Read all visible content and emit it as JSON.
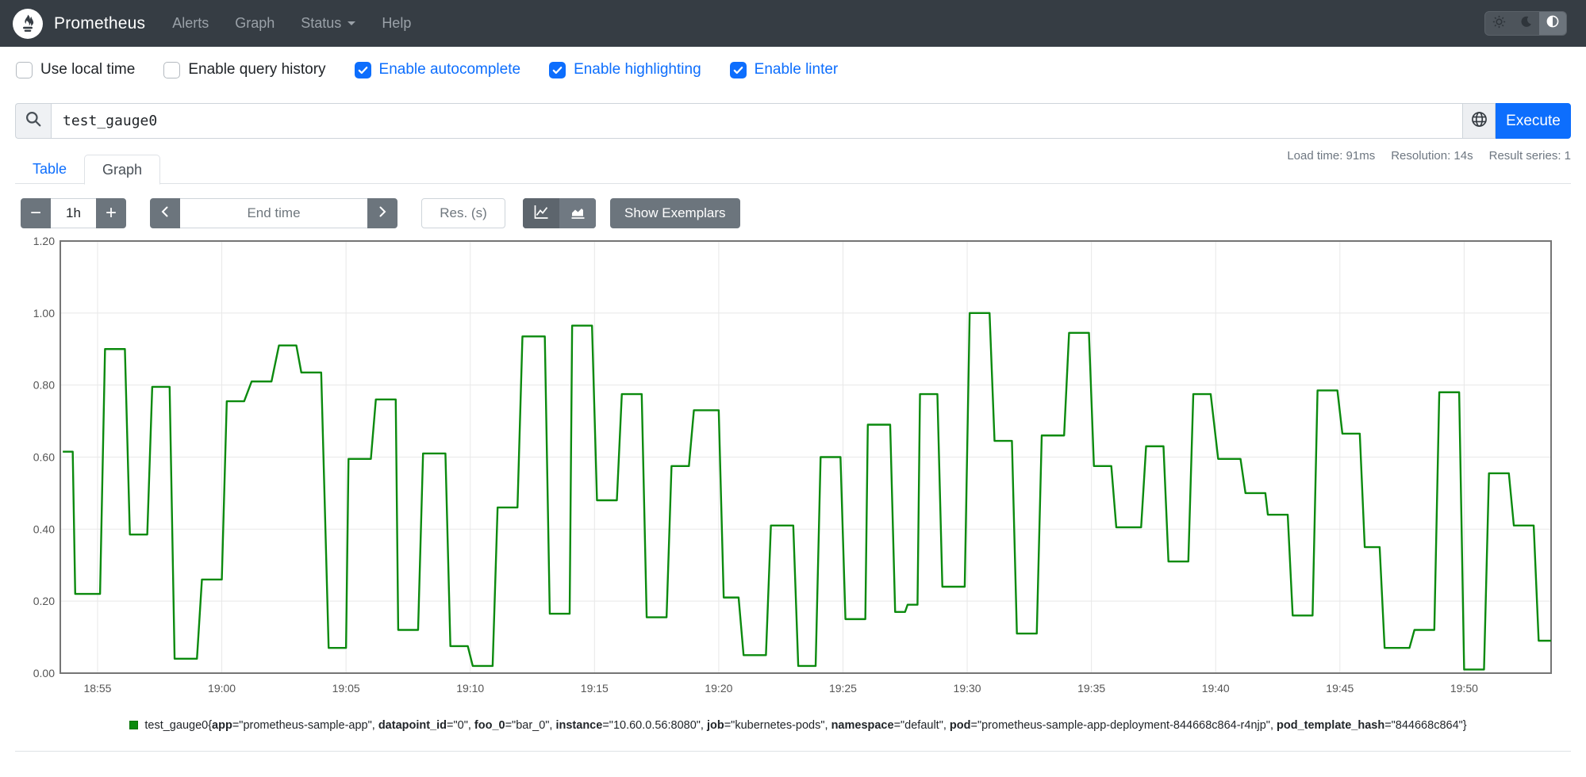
{
  "colors": {
    "accent": "#0d6efd",
    "navbar_bg": "#363d44",
    "series_green": "#0b8a0e",
    "grid": "#e8e8e8",
    "frame": "#757575",
    "tick_text": "#555555"
  },
  "navbar": {
    "brand": "Prometheus",
    "links": [
      {
        "label": "Alerts"
      },
      {
        "label": "Graph"
      },
      {
        "label": "Status"
      },
      {
        "label": "Help"
      }
    ],
    "theme_options": [
      "light",
      "dark",
      "auto"
    ],
    "active_theme": "auto"
  },
  "options": {
    "checkboxes": [
      {
        "label": "Use local time",
        "checked": false
      },
      {
        "label": "Enable query history",
        "checked": false
      },
      {
        "label": "Enable autocomplete",
        "checked": true
      },
      {
        "label": "Enable highlighting",
        "checked": true
      },
      {
        "label": "Enable linter",
        "checked": true
      }
    ]
  },
  "query": {
    "value": "test_gauge0",
    "execute_label": "Execute"
  },
  "stats": {
    "load_time": "Load time: 91ms",
    "resolution": "Resolution: 14s",
    "result_series": "Result series: 1"
  },
  "tabs": [
    {
      "label": "Table",
      "active": false
    },
    {
      "label": "Graph",
      "active": true
    }
  ],
  "graph_controls": {
    "minus": "−",
    "plus": "+",
    "range_value": "1h",
    "end_time_placeholder": "End time",
    "res_placeholder": "Res. (s)",
    "show_exemplars": "Show Exemplars"
  },
  "chart_data": {
    "type": "line",
    "step": true,
    "series_name": "test_gauge0",
    "series_color": "#0b8a0e",
    "ylabel": "",
    "xlabel": "",
    "y_axis": {
      "range": [
        0,
        1.2
      ],
      "tick_labels": [
        "0.00",
        "0.20",
        "0.40",
        "0.60",
        "0.80",
        "1.00",
        "1.20"
      ],
      "tick_values": [
        0,
        0.2,
        0.4,
        0.6,
        0.8,
        1.0,
        1.2
      ]
    },
    "x_axis": {
      "base_time": "18:50",
      "range_minutes": [
        3.5,
        63.5
      ],
      "tick_minutes": [
        5,
        10,
        15,
        20,
        25,
        30,
        35,
        40,
        45,
        50,
        55,
        60
      ],
      "tick_labels": [
        "18:55",
        "19:00",
        "19:05",
        "19:10",
        "19:15",
        "19:20",
        "19:25",
        "19:30",
        "19:35",
        "19:40",
        "19:45",
        "19:50"
      ]
    },
    "grid": true,
    "segments_note": "each segment = [start_minutes_after_18:50, end_minutes, value]",
    "segments": [
      [
        3.6,
        4.0,
        0.615
      ],
      [
        4.1,
        5.1,
        0.22
      ],
      [
        5.3,
        6.1,
        0.9
      ],
      [
        6.3,
        7.0,
        0.385
      ],
      [
        7.2,
        7.9,
        0.795
      ],
      [
        8.1,
        9.0,
        0.04
      ],
      [
        9.2,
        10.0,
        0.26
      ],
      [
        10.2,
        10.9,
        0.755
      ],
      [
        11.2,
        12.0,
        0.81
      ],
      [
        12.3,
        13.0,
        0.91
      ],
      [
        13.2,
        14.0,
        0.835
      ],
      [
        14.3,
        15.0,
        0.07
      ],
      [
        15.1,
        16.0,
        0.595
      ],
      [
        16.2,
        17.0,
        0.76
      ],
      [
        17.1,
        17.9,
        0.12
      ],
      [
        18.1,
        19.0,
        0.61
      ],
      [
        19.2,
        19.9,
        0.075
      ],
      [
        20.1,
        20.9,
        0.02
      ],
      [
        21.1,
        21.9,
        0.46
      ],
      [
        22.1,
        23.0,
        0.935
      ],
      [
        23.2,
        24.0,
        0.165
      ],
      [
        24.1,
        24.9,
        0.965
      ],
      [
        25.1,
        25.9,
        0.48
      ],
      [
        26.1,
        26.9,
        0.775
      ],
      [
        27.1,
        27.9,
        0.155
      ],
      [
        28.1,
        28.8,
        0.575
      ],
      [
        29.0,
        30.0,
        0.73
      ],
      [
        30.2,
        30.8,
        0.21
      ],
      [
        31.0,
        31.9,
        0.05
      ],
      [
        32.1,
        33.0,
        0.41
      ],
      [
        33.2,
        33.9,
        0.02
      ],
      [
        34.1,
        34.9,
        0.6
      ],
      [
        35.1,
        35.9,
        0.15
      ],
      [
        36.0,
        36.9,
        0.69
      ],
      [
        37.1,
        37.5,
        0.17
      ],
      [
        37.6,
        38.0,
        0.19
      ],
      [
        38.1,
        38.8,
        0.775
      ],
      [
        39.0,
        39.9,
        0.24
      ],
      [
        40.1,
        40.9,
        1.0
      ],
      [
        41.1,
        41.8,
        0.645
      ],
      [
        42.0,
        42.8,
        0.11
      ],
      [
        43.0,
        43.9,
        0.66
      ],
      [
        44.1,
        44.9,
        0.945
      ],
      [
        45.1,
        45.8,
        0.575
      ],
      [
        46.0,
        47.0,
        0.405
      ],
      [
        47.2,
        47.9,
        0.63
      ],
      [
        48.1,
        48.9,
        0.31
      ],
      [
        49.1,
        49.8,
        0.775
      ],
      [
        50.1,
        51.0,
        0.595
      ],
      [
        51.2,
        52.0,
        0.5
      ],
      [
        52.1,
        52.9,
        0.44
      ],
      [
        53.1,
        53.9,
        0.16
      ],
      [
        54.1,
        54.9,
        0.785
      ],
      [
        55.1,
        55.8,
        0.665
      ],
      [
        56.0,
        56.6,
        0.35
      ],
      [
        56.8,
        57.8,
        0.07
      ],
      [
        58.0,
        58.8,
        0.12
      ],
      [
        59.0,
        59.8,
        0.78
      ],
      [
        60.0,
        60.8,
        0.01
      ],
      [
        61.0,
        61.8,
        0.555
      ],
      [
        62.0,
        62.8,
        0.41
      ],
      [
        63.0,
        63.5,
        0.09
      ]
    ]
  },
  "legend": {
    "metric": "test_gauge0",
    "labels": [
      [
        "app",
        "prometheus-sample-app"
      ],
      [
        "datapoint_id",
        "0"
      ],
      [
        "foo_0",
        "bar_0"
      ],
      [
        "instance",
        "10.60.0.56:8080"
      ],
      [
        "job",
        "kubernetes-pods"
      ],
      [
        "namespace",
        "default"
      ],
      [
        "pod",
        "prometheus-sample-app-deployment-844668c864-r4njp"
      ],
      [
        "pod_template_hash",
        "844668c864"
      ]
    ]
  }
}
